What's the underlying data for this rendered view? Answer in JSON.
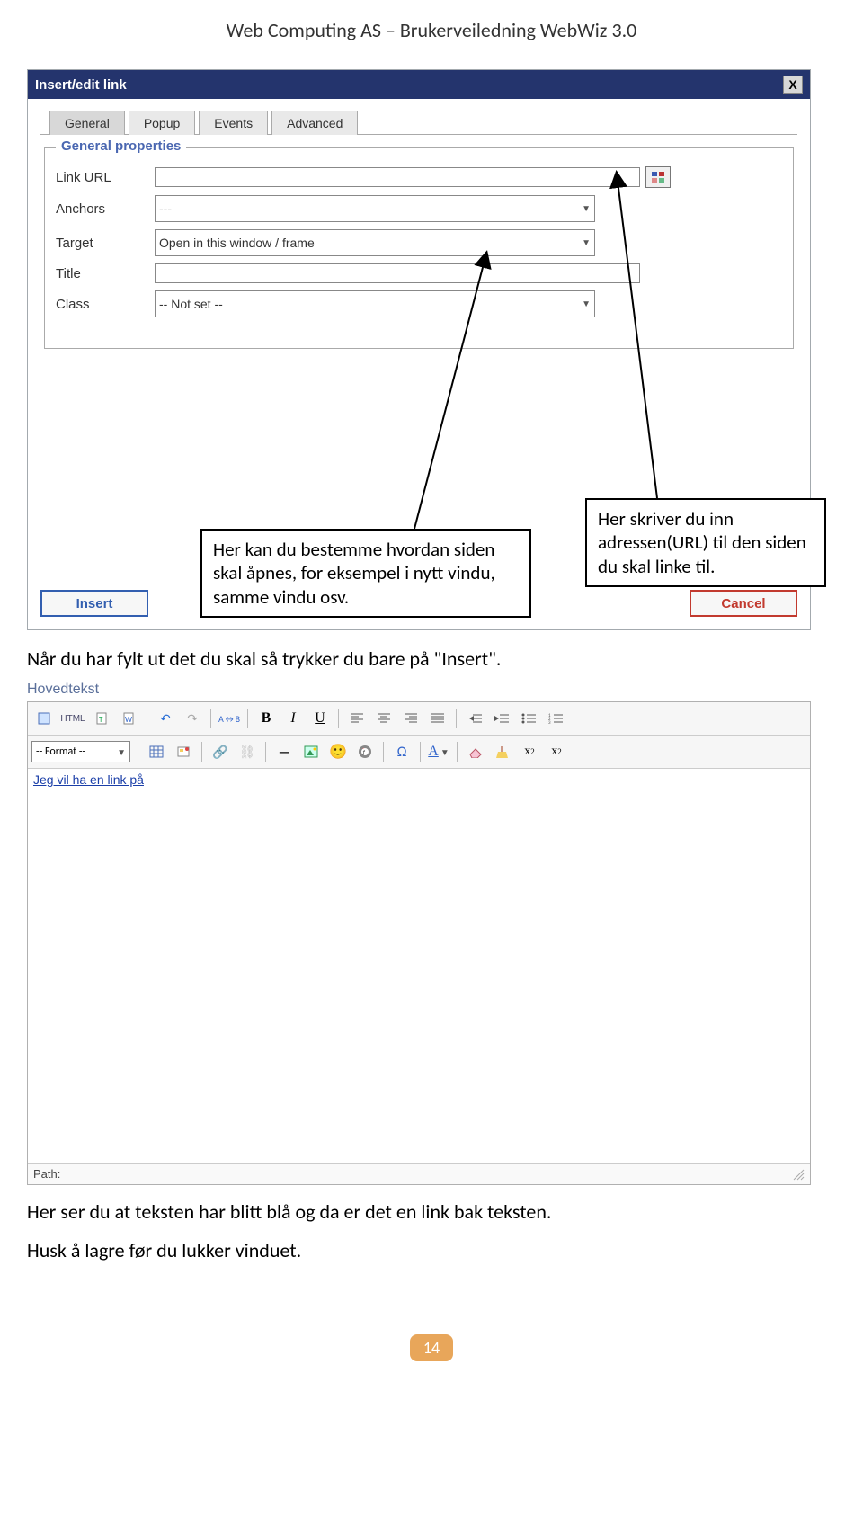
{
  "doc_header": "Web Computing AS – Brukerveiledning WebWiz 3.0",
  "dialog": {
    "title": "Insert/edit link",
    "close_label": "X",
    "tabs": [
      "General",
      "Popup",
      "Events",
      "Advanced"
    ],
    "fieldset_legend": "General properties",
    "fields": {
      "link_url_label": "Link URL",
      "link_url_value": "",
      "anchors_label": "Anchors",
      "anchors_value": "---",
      "target_label": "Target",
      "target_value": "Open in this window / frame",
      "title_label": "Title",
      "title_value": "",
      "class_label": "Class",
      "class_value": "-- Not set --"
    },
    "insert_label": "Insert",
    "cancel_label": "Cancel"
  },
  "callouts": {
    "left": "Her kan du bestemme hvordan siden skal åpnes, for eksempel i nytt vindu, samme vindu osv.",
    "right": "Her skriver du inn adressen(URL) til den siden du skal linke til."
  },
  "body_text_1": "Når du har fylt ut det du skal så trykker du bare på \"Insert\".",
  "editor": {
    "section_label": "Hovedtekst",
    "format_value": "-- Format --",
    "content_link_text": "Jeg vil ha en link på",
    "path_label": "Path:",
    "icons": {
      "html": "HTML",
      "bold": "B",
      "italic": "I",
      "underline": "U"
    }
  },
  "body_text_2": "Her ser du at teksten har blitt blå og da er det en link bak teksten.",
  "body_text_3": "Husk å lagre før du lukker vinduet.",
  "page_number": "14"
}
